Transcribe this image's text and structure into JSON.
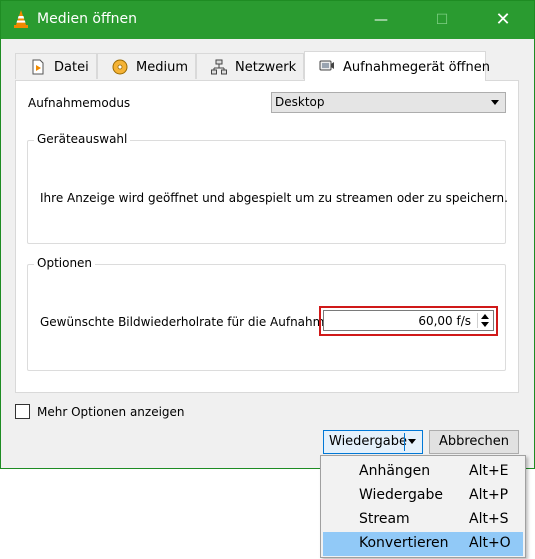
{
  "window": {
    "title": "Medien öffnen",
    "minimize_glyph": "—",
    "maximize_glyph": "☐",
    "close_glyph": "✕"
  },
  "tabs": [
    {
      "label": "Datei",
      "icon": "file-icon"
    },
    {
      "label": "Medium",
      "icon": "disc-icon"
    },
    {
      "label": "Netzwerk",
      "icon": "network-icon"
    },
    {
      "label": "Aufnahmegerät öffnen",
      "icon": "capture-device-icon",
      "active": true
    }
  ],
  "capture": {
    "mode_label": "Aufnahmemodus",
    "mode_value": "Desktop",
    "device_group_title": "Geräteauswahl",
    "device_text": "Ihre Anzeige wird geöffnet und abgespielt um zu streamen oder zu speichern.",
    "options_group_title": "Optionen",
    "framerate_label": "Gewünschte Bildwiederholrate für die Aufnahme",
    "framerate_value": "60,00 f/s"
  },
  "more_options_label": "Mehr Optionen anzeigen",
  "buttons": {
    "play": "Wiedergabe",
    "cancel": "Abbrechen"
  },
  "dropdown_menu": [
    {
      "label": "Anhängen",
      "shortcut": "Alt+E"
    },
    {
      "label": "Wiedergabe",
      "shortcut": "Alt+P"
    },
    {
      "label": "Stream",
      "shortcut": "Alt+S"
    },
    {
      "label": "Konvertieren",
      "shortcut": "Alt+O",
      "highlighted": true
    }
  ],
  "colors": {
    "titlebar": "#2a9b30",
    "highlight": "#91c9f7",
    "focus_outline": "#d01919"
  }
}
